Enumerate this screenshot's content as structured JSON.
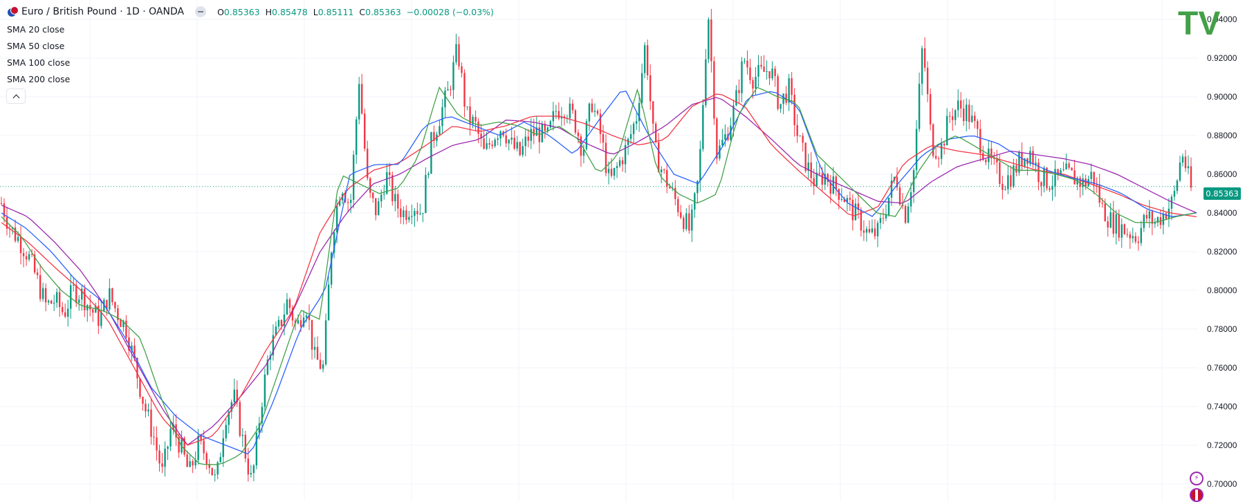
{
  "symbol": {
    "title": "Euro / British Pound · 1D · OANDA",
    "ohlc": {
      "o_label": "O",
      "o": "0.85363",
      "h_label": "H",
      "h": "0.85478",
      "l_label": "L",
      "l": "0.85111",
      "c_label": "C",
      "c": "0.85363",
      "change": "−0.00028 (−0.03%)"
    }
  },
  "indicators": [
    {
      "name": "SMA",
      "source": "20 close"
    },
    {
      "name": "SMA",
      "source": "50 close"
    },
    {
      "name": "SMA",
      "source": "100 close"
    },
    {
      "name": "SMA",
      "source": "200 close"
    }
  ],
  "price_tag": "0.85363",
  "logo_text": "TV",
  "colors": {
    "up": "#089981",
    "down": "#f23645",
    "sma20": "#43a047",
    "sma50": "#2962ff",
    "sma100": "#f23645",
    "sma200": "#9c27b0",
    "grid": "#f0f3fa",
    "last_price": "#089981"
  },
  "chart_data": {
    "type": "candlestick",
    "title": "Euro / British Pound · 1D · OANDA",
    "y_axis_ticks": [
      "0.70000",
      "0.72000",
      "0.74000",
      "0.76000",
      "0.78000",
      "0.80000",
      "0.82000",
      "0.84000",
      "0.86000",
      "0.88000",
      "0.90000",
      "0.92000",
      "0.94000"
    ],
    "ylim": [
      0.691,
      0.95
    ],
    "grid": true,
    "last_price": 0.85363,
    "series_close_path": [
      0.845,
      0.832,
      0.826,
      0.818,
      0.805,
      0.792,
      0.795,
      0.788,
      0.8,
      0.798,
      0.79,
      0.785,
      0.798,
      0.788,
      0.78,
      0.76,
      0.74,
      0.725,
      0.705,
      0.73,
      0.72,
      0.705,
      0.72,
      0.715,
      0.7,
      0.735,
      0.745,
      0.722,
      0.7,
      0.74,
      0.77,
      0.78,
      0.795,
      0.78,
      0.795,
      0.765,
      0.76,
      0.83,
      0.856,
      0.843,
      0.91,
      0.85,
      0.84,
      0.86,
      0.845,
      0.84,
      0.845,
      0.84,
      0.875,
      0.89,
      0.903,
      0.925,
      0.89,
      0.885,
      0.87,
      0.88,
      0.885,
      0.875,
      0.87,
      0.88,
      0.882,
      0.878,
      0.893,
      0.895,
      0.889,
      0.872,
      0.898,
      0.88,
      0.855,
      0.865,
      0.875,
      0.89,
      0.928,
      0.873,
      0.86,
      0.85,
      0.84,
      0.83,
      0.86,
      0.946,
      0.87,
      0.88,
      0.895,
      0.92,
      0.91,
      0.912,
      0.915,
      0.895,
      0.905,
      0.88,
      0.865,
      0.855,
      0.86,
      0.854,
      0.85,
      0.842,
      0.836,
      0.828,
      0.83,
      0.845,
      0.86,
      0.838,
      0.862,
      0.928,
      0.875,
      0.872,
      0.89,
      0.895,
      0.892,
      0.882,
      0.87,
      0.863,
      0.856,
      0.86,
      0.868,
      0.872,
      0.86,
      0.856,
      0.857,
      0.86,
      0.858,
      0.855,
      0.86,
      0.843,
      0.836,
      0.833,
      0.83,
      0.828,
      0.838,
      0.835,
      0.84,
      0.846,
      0.872,
      0.852
    ],
    "sma20_path": [
      0.838,
      0.828,
      0.812,
      0.8,
      0.792,
      0.79,
      0.785,
      0.775,
      0.745,
      0.72,
      0.71,
      0.71,
      0.715,
      0.73,
      0.76,
      0.79,
      0.785,
      0.86,
      0.855,
      0.85,
      0.853,
      0.87,
      0.905,
      0.89,
      0.885,
      0.887,
      0.885,
      0.88,
      0.885,
      0.878,
      0.86,
      0.87,
      0.905,
      0.86,
      0.85,
      0.845,
      0.85,
      0.89,
      0.905,
      0.9,
      0.897,
      0.87,
      0.86,
      0.85,
      0.84,
      0.838,
      0.86,
      0.875,
      0.88,
      0.874,
      0.868,
      0.862,
      0.862,
      0.86,
      0.857,
      0.85,
      0.84,
      0.835,
      0.835,
      0.838,
      0.84
    ],
    "sma50_path": [
      0.84,
      0.832,
      0.82,
      0.805,
      0.795,
      0.775,
      0.75,
      0.735,
      0.725,
      0.72,
      0.715,
      0.745,
      0.78,
      0.8,
      0.86,
      0.865,
      0.865,
      0.885,
      0.89,
      0.885,
      0.88,
      0.887,
      0.88,
      0.87,
      0.888,
      0.905,
      0.88,
      0.86,
      0.855,
      0.875,
      0.9,
      0.903,
      0.895,
      0.86,
      0.845,
      0.838,
      0.855,
      0.87,
      0.878,
      0.88,
      0.876,
      0.868,
      0.862,
      0.858,
      0.855,
      0.85,
      0.842,
      0.838,
      0.84
    ],
    "sma100_path": [
      0.835,
      0.825,
      0.812,
      0.8,
      0.785,
      0.76,
      0.735,
      0.72,
      0.725,
      0.745,
      0.77,
      0.79,
      0.83,
      0.852,
      0.862,
      0.866,
      0.875,
      0.885,
      0.882,
      0.885,
      0.89,
      0.89,
      0.886,
      0.88,
      0.875,
      0.878,
      0.895,
      0.902,
      0.895,
      0.875,
      0.862,
      0.85,
      0.838,
      0.843,
      0.866,
      0.875,
      0.872,
      0.87,
      0.866,
      0.862,
      0.86,
      0.855,
      0.85,
      0.844,
      0.84,
      0.838
    ],
    "sma200_path": [
      0.844,
      0.838,
      0.825,
      0.81,
      0.79,
      0.765,
      0.74,
      0.72,
      0.73,
      0.745,
      0.762,
      0.79,
      0.82,
      0.84,
      0.855,
      0.86,
      0.868,
      0.875,
      0.878,
      0.888,
      0.887,
      0.884,
      0.876,
      0.87,
      0.877,
      0.885,
      0.896,
      0.9,
      0.89,
      0.878,
      0.865,
      0.858,
      0.852,
      0.846,
      0.845,
      0.856,
      0.864,
      0.868,
      0.872,
      0.87,
      0.868,
      0.865,
      0.86,
      0.853,
      0.846,
      0.84
    ]
  }
}
